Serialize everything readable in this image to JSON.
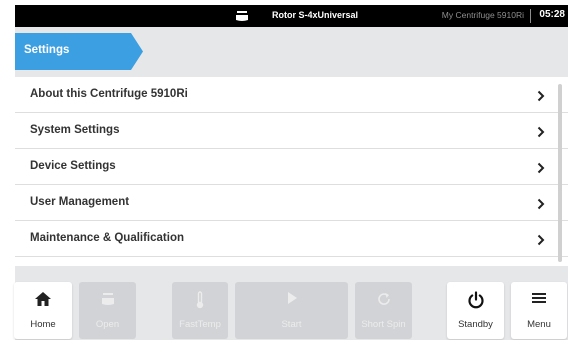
{
  "status_bar": {
    "rotor": "Rotor S-4xUniversal",
    "device_name": "My Centrifuge 5910Ri",
    "time": "05:28"
  },
  "breadcrumb": {
    "title": "Settings"
  },
  "settings_list": [
    {
      "label": "About this Centrifuge 5910Ri"
    },
    {
      "label": "System Settings"
    },
    {
      "label": "Device Settings"
    },
    {
      "label": "User Management"
    },
    {
      "label": "Maintenance & Qualification"
    }
  ],
  "toolbar": {
    "home": {
      "label": "Home",
      "icon": "home-icon",
      "enabled": true
    },
    "open": {
      "label": "Open",
      "icon": "lid-open-icon",
      "enabled": false
    },
    "fasttemp": {
      "label": "FastTemp",
      "icon": "thermometer-icon",
      "enabled": false
    },
    "start": {
      "label": "Start",
      "icon": "play-icon",
      "enabled": false
    },
    "short_spin": {
      "label": "Short Spin",
      "icon": "short-spin-icon",
      "enabled": false
    },
    "standby": {
      "label": "Standby",
      "icon": "power-icon",
      "enabled": true
    },
    "menu": {
      "label": "Menu",
      "icon": "hamburger-icon",
      "enabled": true
    }
  },
  "colors": {
    "accent": "#3c9fe2",
    "status_bar": "#000000",
    "background": "#e6e7e9",
    "disabled_button": "#d2d3d6"
  }
}
